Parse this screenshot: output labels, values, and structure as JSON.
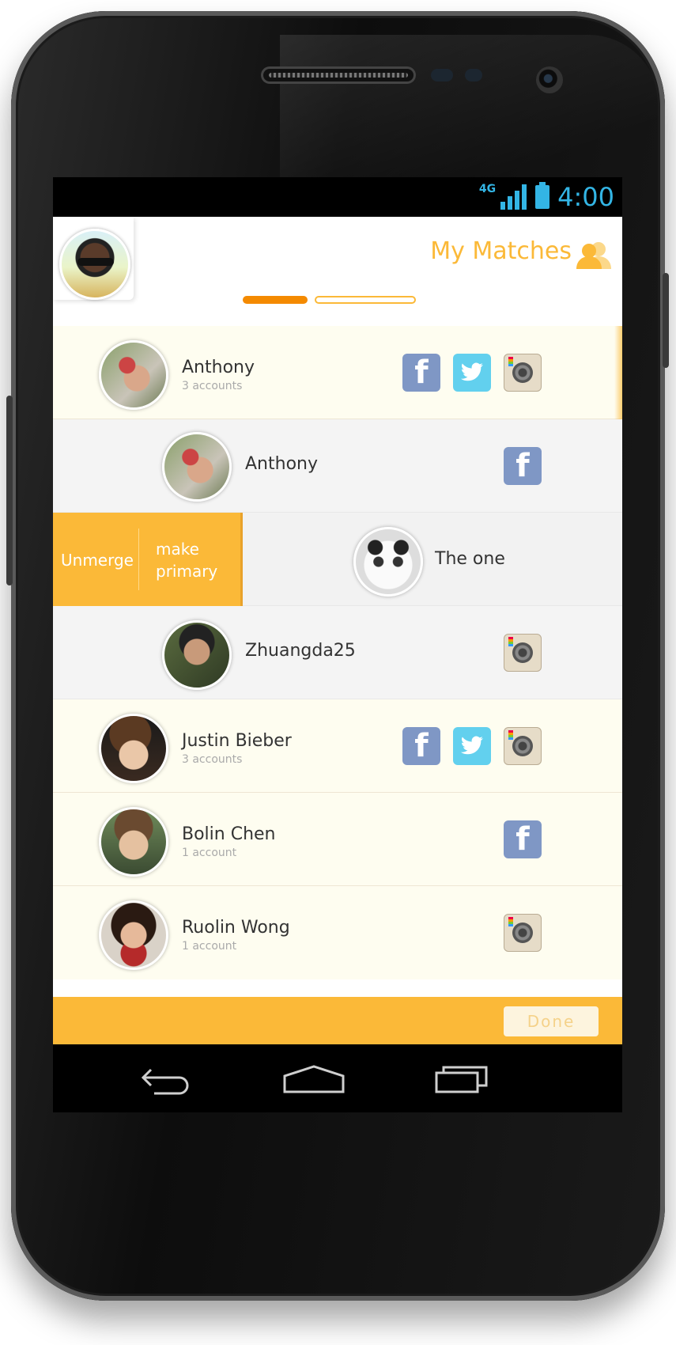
{
  "status_bar": {
    "network": "4G",
    "time": "4:00"
  },
  "header": {
    "title": "My Matches",
    "icon": "people-icon",
    "accent": "#fbb938",
    "progress_active": "#f48a00"
  },
  "matches": [
    {
      "name": "Anthony",
      "count": "3 accounts",
      "networks": [
        "facebook",
        "twitter",
        "instagram"
      ]
    },
    {
      "name": "Anthony",
      "networks": [
        "facebook"
      ]
    },
    {
      "name": "The one",
      "actions": {
        "unmerge": "Unmerge",
        "make_primary": "make primary"
      }
    },
    {
      "name": "Zhuangda25",
      "networks": [
        "instagram"
      ]
    },
    {
      "name": "Justin Bieber",
      "count": "3 accounts",
      "networks": [
        "facebook",
        "twitter",
        "instagram"
      ]
    },
    {
      "name": "Bolin Chen",
      "count": "1 account",
      "networks": [
        "facebook"
      ]
    },
    {
      "name": "Ruolin Wong",
      "count": "1 account",
      "networks": [
        "instagram"
      ]
    }
  ],
  "footer": {
    "done_label": "Done"
  },
  "navbar": {
    "icons": [
      "back-icon",
      "home-icon",
      "recent-apps-icon"
    ]
  }
}
